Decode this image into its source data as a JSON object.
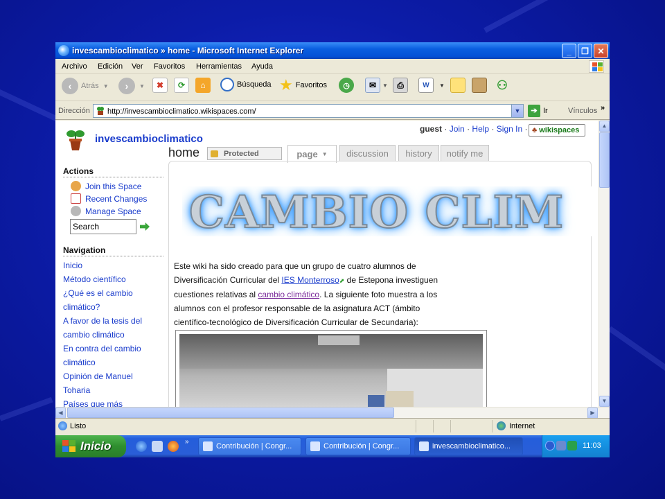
{
  "window": {
    "title": "invescambioclimatico » home - Microsoft Internet Explorer"
  },
  "menu": [
    "Archivo",
    "Edición",
    "Ver",
    "Favoritos",
    "Herramientas",
    "Ayuda"
  ],
  "toolbar": {
    "back_label": "Atrás",
    "search_label": "Búsqueda",
    "favorites_label": "Favoritos"
  },
  "address": {
    "label": "Dirección",
    "url": "http://invescambioclimatico.wikispaces.com/",
    "go_label": "Ir",
    "links_label": "Vínculos"
  },
  "wiki": {
    "site_name": "invescambioclimatico",
    "userbar": {
      "user": "guest",
      "sep": "·",
      "join": "Join",
      "help": "Help",
      "sign_in": "Sign In"
    },
    "brand": "wikispaces",
    "page_title": "home",
    "protected_label": "Protected",
    "tabs": {
      "page": "page",
      "discussion": "discussion",
      "history": "history",
      "notify": "notify me"
    },
    "actions_heading": "Actions",
    "actions": {
      "join": "Join this Space",
      "recent": "Recent Changes",
      "manage": "Manage Space"
    },
    "search_value": "Search",
    "navigation_heading": "Navigation",
    "nav": {
      "n0": "Inicio",
      "n1": "Método científico",
      "n2": "¿Qué es el cambio",
      "n3": "climático?",
      "n4": "A favor de la tesis del",
      "n5": "cambio climático",
      "n6": "En contra del cambio",
      "n7": "climático",
      "n8": "Opinión de Manuel",
      "n9": "Toharia",
      "n10": "Países que más"
    },
    "banner_text": "CAMBIO CLIM",
    "intro": {
      "l1": "Este wiki ha sido creado para que un grupo de cuatro alumnos de",
      "l2a": "Diversificación Curricular del ",
      "l2link": "IES Monterroso",
      "l2b": " de Estepona investiguen",
      "l3a": "cuestiones relativas al ",
      "l3link": "cambio climático",
      "l3b": ". La siguiente foto muestra a los",
      "l4": "alumnos con el profesor responsable de la asignatura ACT (ámbito",
      "l5": "científico-tecnológico de Diversificación Curricular de Secundaria):"
    }
  },
  "status": {
    "text": "Listo",
    "zone": "Internet"
  },
  "taskbar": {
    "start_label": "Inicio",
    "tasks": {
      "t1": "Contribución | Congr...",
      "t2": "Contribución | Congr...",
      "t3": "invescambioclimatico..."
    },
    "clock": "11:03"
  }
}
